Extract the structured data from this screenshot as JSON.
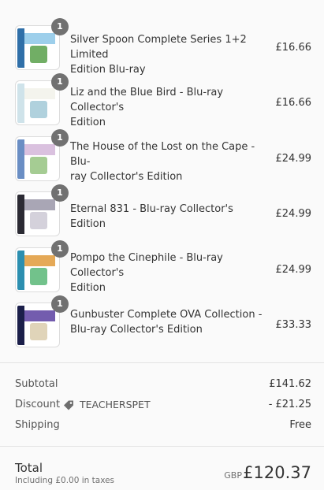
{
  "items": [
    {
      "title_line1": "Silver Spoon Complete Series 1+2 Limited",
      "title_line2": "Edition Blu-ray",
      "price": "£16.66",
      "qty": "1",
      "colors": [
        "#2f6fa8",
        "#8cc7e8",
        "#4e9a3f"
      ]
    },
    {
      "title_line1": "Liz and the Blue Bird - Blu-ray Collector's",
      "title_line2": "Edition",
      "price": "£16.66",
      "qty": "1",
      "colors": [
        "#cfe3ea",
        "#f2f2ea",
        "#9cc5d4"
      ]
    },
    {
      "title_line1": "The House of the Lost on the Cape - Blu-",
      "title_line2": "ray Collector's Edition",
      "price": "£24.99",
      "qty": "1",
      "colors": [
        "#6a8ec4",
        "#d4b6d9",
        "#8fbf78"
      ]
    },
    {
      "title_line1": "Eternal 831 - Blu-ray Collector's Edition",
      "title_line2": "",
      "price": "£24.99",
      "qty": "1",
      "colors": [
        "#2b2a33",
        "#9a96a8",
        "#c9c6d2"
      ]
    },
    {
      "title_line1": "Pompo the Cinephile - Blu-ray Collector's",
      "title_line2": "Edition",
      "price": "£24.99",
      "qty": "1",
      "colors": [
        "#2c8fb0",
        "#e09a3a",
        "#4fb36e"
      ]
    },
    {
      "title_line1": "Gunbuster Complete OVA Collection -",
      "title_line2": "Blu-ray Collector's Edition",
      "price": "£33.33",
      "qty": "1",
      "colors": [
        "#1b1f4a",
        "#5b3fa0",
        "#d8c9a8"
      ]
    }
  ],
  "summary": {
    "subtotal_label": "Subtotal",
    "subtotal_value": "£141.62",
    "discount_label": "Discount",
    "discount_code": "TEACHERSPET",
    "discount_icon": "tag-icon",
    "discount_value": "- £21.25",
    "shipping_label": "Shipping",
    "shipping_value": "Free"
  },
  "total": {
    "label": "Total",
    "tax_note": "Including £0.00 in taxes",
    "currency": "GBP",
    "value": "£120.37"
  }
}
